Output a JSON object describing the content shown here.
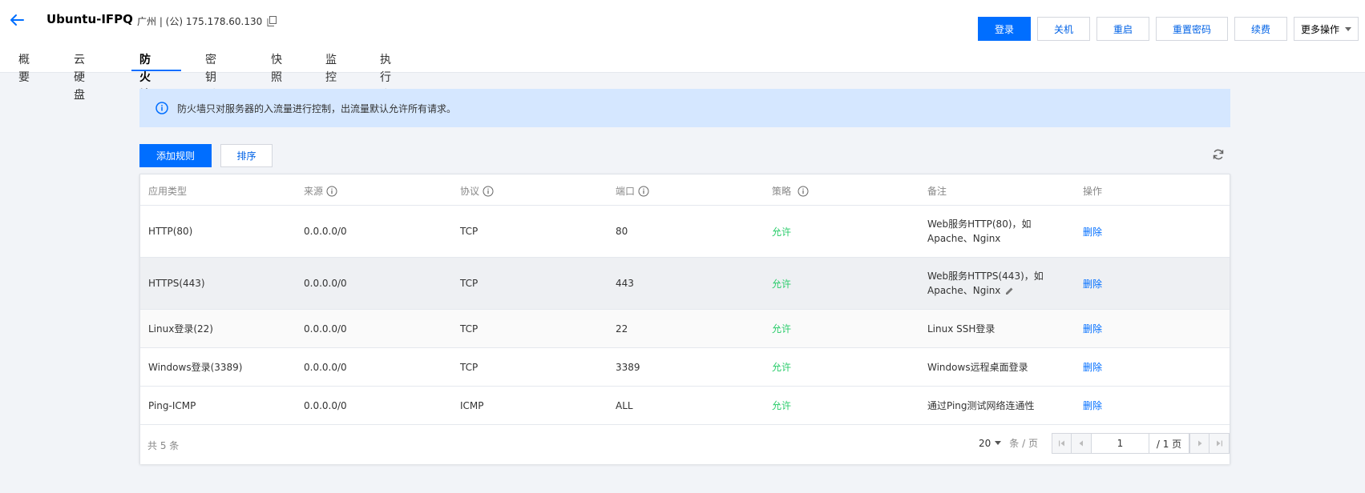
{
  "header": {
    "title": "Ubuntu-IFPQ",
    "region_ip": "广州 | (公) 175.178.60.130",
    "buttons": {
      "login": "登录",
      "shutdown": "关机",
      "restart": "重启",
      "reset_password": "重置密码",
      "renew": "续费",
      "more": "更多操作"
    }
  },
  "tabs": [
    {
      "label": "概要"
    },
    {
      "label": "云硬盘"
    },
    {
      "label": "防火墙",
      "active": true
    },
    {
      "label": "密钥对"
    },
    {
      "label": "快照"
    },
    {
      "label": "监控"
    },
    {
      "label": "执行命令"
    }
  ],
  "notice": {
    "text": "防火墙只对服务器的入流量进行控制，出流量默认允许所有请求。"
  },
  "toolbar": {
    "add_rule": "添加规则",
    "sort": "排序"
  },
  "table": {
    "columns": [
      "应用类型",
      "来源",
      "协议",
      "端口",
      "策略",
      "备注",
      "操作"
    ],
    "rows": [
      {
        "type": "HTTP(80)",
        "source": "0.0.0.0/0",
        "protocol": "TCP",
        "port": "80",
        "policy": "允许",
        "remark_line1": "Web服务HTTP(80)，如",
        "remark_line2": "Apache、Nginx",
        "action": "删除"
      },
      {
        "type": "HTTPS(443)",
        "source": "0.0.0.0/0",
        "protocol": "TCP",
        "port": "443",
        "policy": "允许",
        "remark_line1": "Web服务HTTPS(443)，如",
        "remark_line2": "Apache、Nginx",
        "action": "删除"
      },
      {
        "type": "Linux登录(22)",
        "source": "0.0.0.0/0",
        "protocol": "TCP",
        "port": "22",
        "policy": "允许",
        "remark_line1": "Linux SSH登录",
        "action": "删除"
      },
      {
        "type": "Windows登录(3389)",
        "source": "0.0.0.0/0",
        "protocol": "TCP",
        "port": "3389",
        "policy": "允许",
        "remark_line1": "Windows远程桌面登录",
        "action": "删除"
      },
      {
        "type": "Ping-ICMP",
        "source": "0.0.0.0/0",
        "protocol": "ICMP",
        "port": "ALL",
        "policy": "允许",
        "remark_line1": "通过Ping测试网络连通性",
        "action": "删除"
      }
    ]
  },
  "pagination": {
    "total": "共 5 条",
    "page_size": "20",
    "per_page_label": "条 / 页",
    "current_page": "1",
    "total_pages": "/ 1 页"
  },
  "colors": {
    "accent": "#006eff",
    "allow_green": "#29cc6a",
    "notice_bg": "#d5e7ff"
  }
}
